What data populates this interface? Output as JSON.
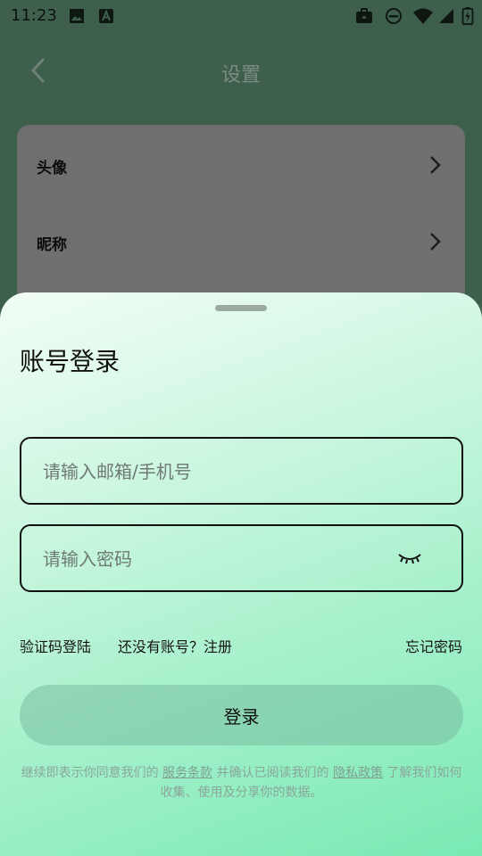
{
  "status_bar": {
    "time": "11:23",
    "left_icons": [
      "image-icon",
      "font-icon"
    ],
    "right_icons": [
      "briefcase-icon",
      "dnd-icon",
      "wifi-icon",
      "signal-icon",
      "battery-charging-icon"
    ]
  },
  "settings_page": {
    "title": "设置",
    "rows": [
      {
        "label": "头像"
      },
      {
        "label": "昵称"
      }
    ]
  },
  "login_sheet": {
    "title": "账号登录",
    "account_placeholder": "请输入邮箱/手机号",
    "password_placeholder": "请输入密码",
    "sms_login": "验证码登陆",
    "register": "还没有账号？注册",
    "forgot_password": "忘记密码",
    "login_button": "登录",
    "terms": {
      "prefix": "继续即表示你同意我们的 ",
      "terms_link": "服务条款",
      "middle": " 并确认已阅读我们的 ",
      "privacy_link": "隐私政策",
      "suffix": " 了解我们如何收集、使用及分享你的数据。"
    }
  },
  "colors": {
    "overlay_bg": "#3f5f4d",
    "card_bg": "#6f6f6f",
    "sheet_gradient_start": "#f2fdf6",
    "sheet_gradient_end": "#79eab4",
    "button_bg": "#a4d9bd"
  }
}
